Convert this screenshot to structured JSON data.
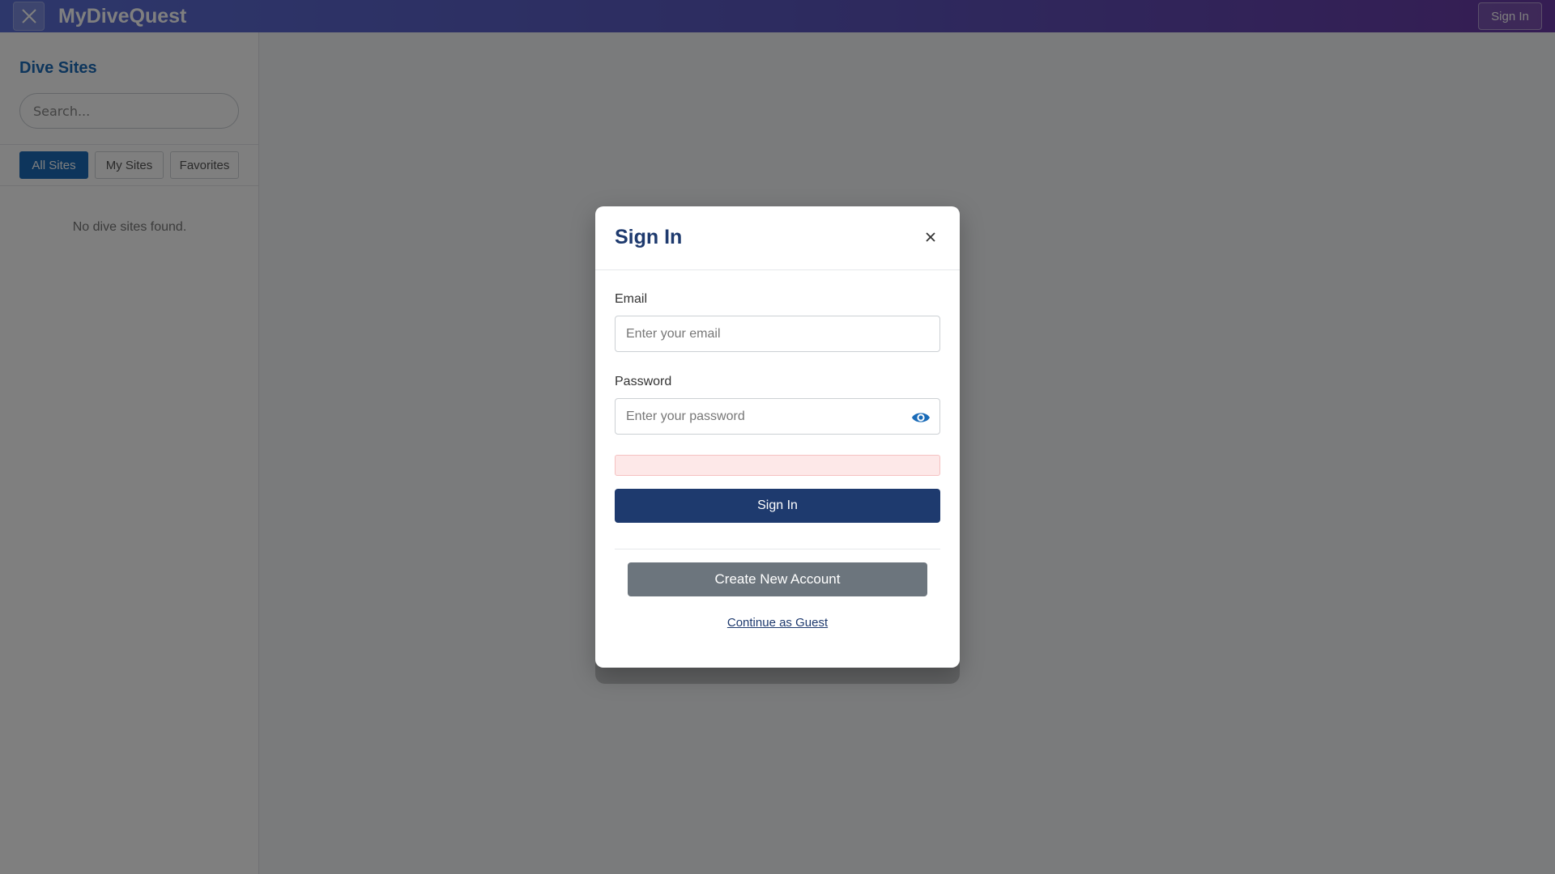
{
  "header": {
    "app_title": "MyDiveQuest",
    "sign_in_label": "Sign In",
    "menu_icon": "close-icon"
  },
  "sidebar": {
    "title": "Dive Sites",
    "search_placeholder": "Search...",
    "filters": [
      {
        "label": "All Sites",
        "active": true
      },
      {
        "label": "My Sites",
        "active": false
      },
      {
        "label": "Favorites",
        "active": false
      }
    ],
    "empty_text": "No dive sites found."
  },
  "modal": {
    "title": "Sign In",
    "close_icon": "close-icon",
    "email_label": "Email",
    "email_placeholder": "Enter your email",
    "email_value": "",
    "password_label": "Password",
    "password_placeholder": "Enter your password",
    "password_value": "",
    "password_toggle_icon": "eye-icon",
    "error_text": "",
    "submit_label": "Sign In",
    "create_account_label": "Create New Account",
    "guest_label": "Continue as Guest"
  },
  "colors": {
    "header_gradient_start": "#5a6fd6",
    "header_gradient_end": "#6a3aa6",
    "accent": "#1a6bb8",
    "primary_dark": "#1e3a6e",
    "secondary": "#6c757d",
    "error_bg": "#fde8e8"
  }
}
